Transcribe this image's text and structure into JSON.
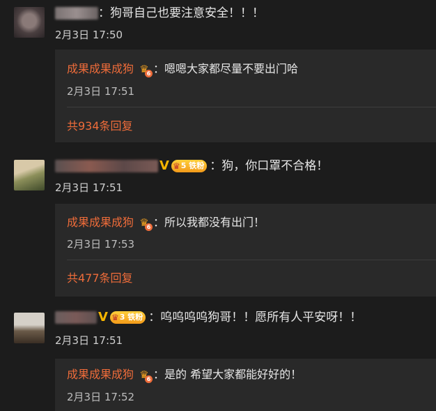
{
  "colors": {
    "background": "#1c1c1c",
    "reply_background": "#292929",
    "accent": "#ee6c3a",
    "vip_gold": "#f5b400"
  },
  "comments": [
    {
      "content": "：狗哥自己也要注意安全！！！",
      "time": "2月3日 17:50",
      "name_visible": "",
      "fan_badge": "",
      "reply": {
        "author": "成果成果成狗",
        "vip_level": "6",
        "content": "：嗯嗯大家都尽量不要出门哈",
        "time": "2月3日 17:51"
      },
      "total_replies": "共934条回复"
    },
    {
      "content": "：狗，你口罩不合格！",
      "time": "2月3日 17:51",
      "name_visible": "",
      "fan_badge": "铁粉",
      "fan_level": "5",
      "reply": {
        "author": "成果成果成狗",
        "vip_level": "6",
        "content": "：所以我都没有出门！",
        "time": "2月3日 17:53"
      },
      "total_replies": "共477条回复"
    },
    {
      "content": "：呜呜呜呜狗哥！！愿所有人平安呀！！",
      "time": "2月3日 17:51",
      "name_visible": "",
      "fan_badge": "铁粉",
      "fan_level": "3",
      "reply": {
        "author": "成果成果成狗",
        "vip_level": "6",
        "content": "：是的 希望大家都能好好的！",
        "time": "2月3日 17:52"
      }
    }
  ]
}
